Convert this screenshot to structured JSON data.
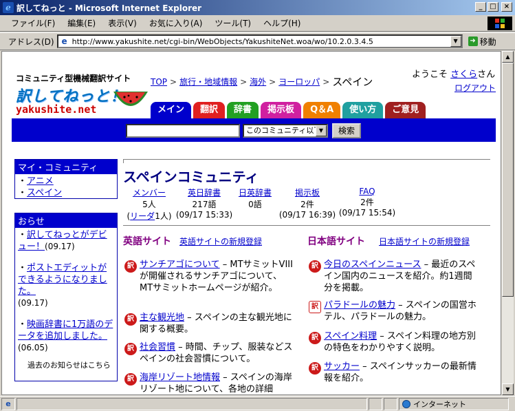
{
  "window": {
    "title": "訳してねっと - Microsoft Internet Explorer"
  },
  "menu": {
    "items": [
      "ファイル(F)",
      "編集(E)",
      "表示(V)",
      "お気に入り(A)",
      "ツール(T)",
      "ヘルプ(H)"
    ]
  },
  "address": {
    "label": "アドレス(D)",
    "url": "http://www.yakushite.net/cgi-bin/WebObjects/YakushiteNet.woa/wo/10.2.0.3.4.5",
    "go_label": "移動"
  },
  "status": {
    "zone": "インターネット"
  },
  "site": {
    "tagline": "コミュニティ型機械翻訳サイト",
    "logo": "訳してねっと！",
    "domain": "yakushite.net",
    "welcome_prefix": "ようこそ",
    "username": "さくら",
    "welcome_suffix": "さん",
    "logout": "ログアウト"
  },
  "breadcrumb": {
    "items": [
      "TOP",
      "旅行・地域情報",
      "海外",
      "ヨーロッパ"
    ],
    "current": "スペイン",
    "sep": ">"
  },
  "tabs": [
    {
      "label": "メイン",
      "color": "#0000cc"
    },
    {
      "label": "翻訳",
      "color": "#e02020"
    },
    {
      "label": "辞書",
      "color": "#22a022"
    },
    {
      "label": "掲示板",
      "color": "#d020a0"
    },
    {
      "label": "Q＆A",
      "color": "#f08000"
    },
    {
      "label": "使い方",
      "color": "#20a0a0"
    },
    {
      "label": "ご意見",
      "color": "#a02020"
    }
  ],
  "search": {
    "value": "",
    "scope": "このコミュニティ以下",
    "button": "検索"
  },
  "my_community": {
    "title": "マイ・コミュニティ",
    "items": [
      "アニメ",
      "スペイン"
    ]
  },
  "news": {
    "title": "おらせ",
    "items": [
      {
        "text": "訳してねっとがデビュー！",
        "date": "(09.17)"
      },
      {
        "text": "ポストエディットができるようになりました。",
        "date": "(09.17)"
      },
      {
        "text": "映画辞書に1万語のデータを追加しました。",
        "date": "(06.05)"
      }
    ],
    "past": "過去のお知らせはこちら"
  },
  "community": {
    "title": "スペインコミュニティ",
    "stats": [
      {
        "label": "メンバー",
        "value": "5人",
        "sub_prefix": "(",
        "sub_link": "リーダ",
        "sub_suffix": "1人)"
      },
      {
        "label": "英日辞書",
        "value": "217語",
        "sub": "(09/17 15:33)"
      },
      {
        "label": "日英辞書",
        "value": "0語",
        "sub": ""
      },
      {
        "label": "掲示板",
        "value": "2件",
        "sub": "(09/17 16:39)"
      },
      {
        "label": "FAQ",
        "value": "2件",
        "sub": "(09/17 15:54)"
      }
    ]
  },
  "english_sites": {
    "title": "英語サイト",
    "register": "英語サイトの新規登録",
    "items": [
      {
        "link": "サンチアゴについて",
        "desc": " – MTサミットVIIIが開催されるサンチアゴについて、MTサミットホームページが紹介。"
      },
      {
        "link": "主な観光地",
        "desc": " – スペインの主な観光地に関する概要。"
      },
      {
        "link": "社会習慣",
        "desc": " – 時間、チップ、服装などスペインの社会習慣について。"
      },
      {
        "link": "海岸リゾート地情報",
        "desc": " – スペインの海岸リゾート地について、各地の詳細"
      }
    ]
  },
  "japanese_sites": {
    "title": "日本語サイト",
    "register": "日本語サイトの新規登録",
    "items": [
      {
        "link": "今日のスペインニュース",
        "desc": " – 最近のスペイン国内のニュースを紹介。約1週間分を掲載。"
      },
      {
        "link": "パラドールの魅力",
        "desc": " – スペインの国営ホテル、パラドールの魅力。"
      },
      {
        "link": "スペイン料理",
        "desc": " – スペイン料理の地方別の特色をわかりやすく説明。"
      },
      {
        "link": "サッカー",
        "desc": " – スペインサッカーの最新情報を紹介。"
      }
    ]
  },
  "badge_label": "訳"
}
